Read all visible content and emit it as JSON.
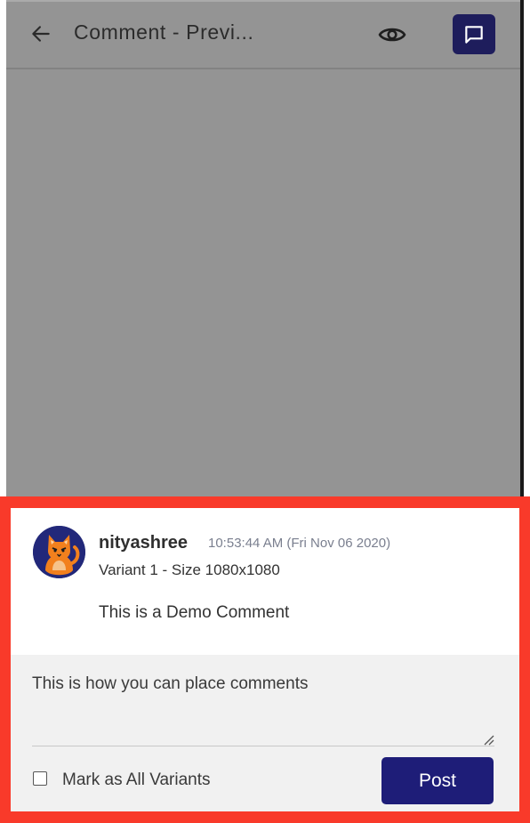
{
  "header": {
    "title": "Comment - Previ...",
    "back_icon": "arrow-left-icon",
    "preview_icon": "eye-icon",
    "comments_icon": "comment-icon",
    "accent": "#1e1d5c"
  },
  "comment": {
    "username": "nityashree",
    "timestamp": "10:53:44 AM (Fri Nov 06 2020)",
    "variant": "Variant 1 - Size 1080x1080",
    "text": "This is a Demo Comment",
    "avatar_icon": "cat-avatar-icon"
  },
  "compose": {
    "input_value": "This is how you can place comments",
    "checkbox_label": "Mark as All Variants",
    "checkbox_checked": false,
    "post_label": "Post",
    "post_color": "#1e1d78"
  },
  "highlight_color": "#f93a2a"
}
